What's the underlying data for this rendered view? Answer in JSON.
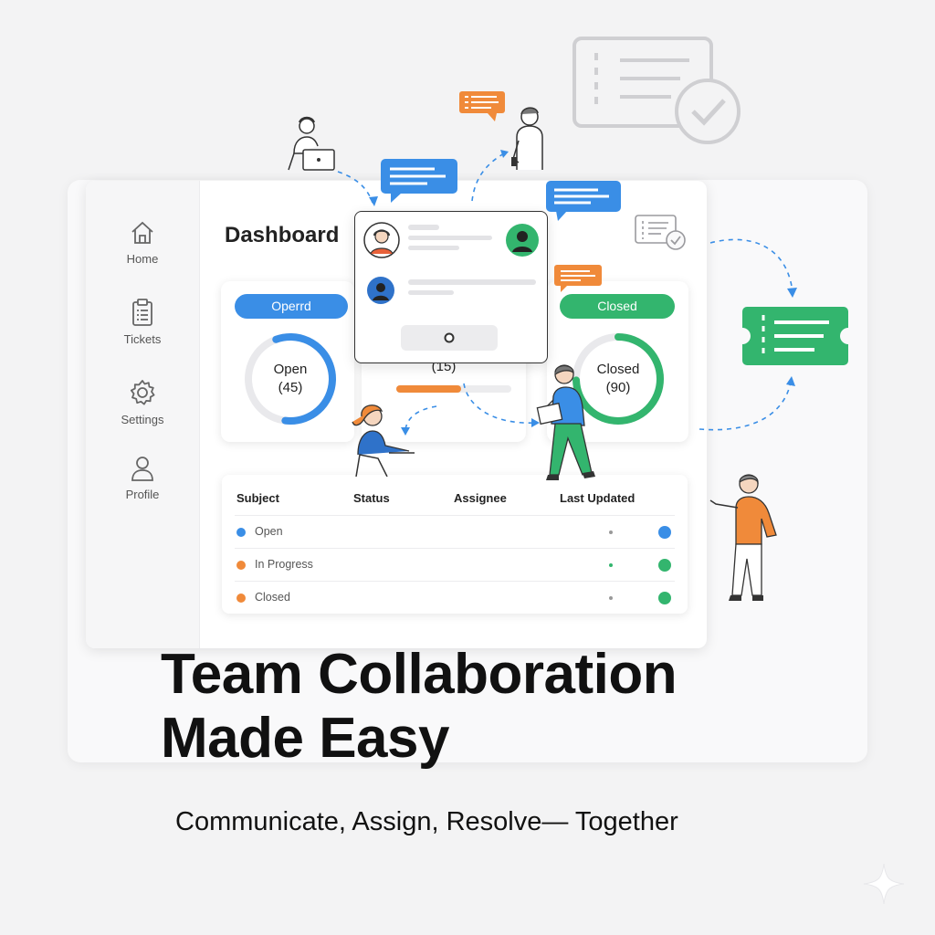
{
  "sidebar": {
    "items": [
      {
        "label": "Home",
        "icon": "home-icon"
      },
      {
        "label": "Tickets",
        "icon": "clipboard-icon"
      },
      {
        "label": "Settings",
        "icon": "gear-icon"
      },
      {
        "label": "Profile",
        "icon": "user-icon"
      }
    ]
  },
  "dashboard": {
    "title": "Dashboard",
    "cards": [
      {
        "pill": "Operrd",
        "ring_label": "Open",
        "ring_count": "(45)",
        "color": "#3a8ee6"
      },
      {
        "ring_count": "(15)",
        "color": "#f08a3a"
      },
      {
        "pill": "Closed",
        "ring_label": "Closed",
        "ring_count": "(90)",
        "color": "#33b56e"
      }
    ]
  },
  "table": {
    "headers": [
      "Subject",
      "Status",
      "Assignee",
      "Last Updated"
    ],
    "rows": [
      {
        "label": "Open",
        "dot_color": "#3a8ee6",
        "end_color": "#3a8ee6"
      },
      {
        "label": "In Progress",
        "dot_color": "#f08a3a",
        "end_color": "#33b56e"
      },
      {
        "label": "Closed",
        "dot_color": "#f08a3a",
        "end_color": "#33b56e"
      }
    ]
  },
  "hero": {
    "headline_line1": "Team Collaboration",
    "headline_line2": "Made Easy",
    "subline": "Communicate, Assign, Resolve— Together"
  },
  "colors": {
    "blue": "#3a8ee6",
    "orange": "#f08a3a",
    "green": "#33b56e"
  }
}
